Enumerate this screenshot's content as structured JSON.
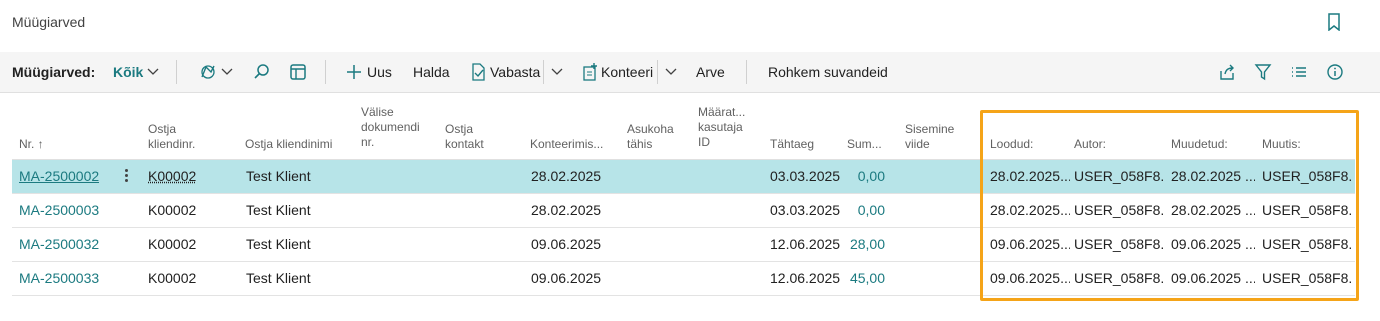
{
  "page": {
    "title": "Müügiarved"
  },
  "toolbar": {
    "list_label": "Müügiarved:",
    "filter_value": "Kõik",
    "new_label": "Uus",
    "manage_label": "Halda",
    "release_label": "Vabasta",
    "post_label": "Konteeri",
    "invoice_label": "Arve",
    "more_label": "Rohkem suvandeid"
  },
  "columns": {
    "nr": "Nr. ↑",
    "customer_no": "Ostja\nkliendinr.",
    "customer_name": "Ostja kliendinimi",
    "ext_doc": "Välise\ndokumendi\nnr.",
    "contact": "Ostja\nkontakt",
    "posting_date": "Konteerimis...",
    "location": "Asukoha\ntähis",
    "assigned_user": "Määrat...\nkasutaja\nID",
    "due_date": "Tähtaeg",
    "amount": "Sum...",
    "internal_ref": "Sisemine\nviide",
    "created": "Loodud:",
    "author": "Autor:",
    "modified": "Muudetud:",
    "modified_by": "Muutis:"
  },
  "rows": [
    {
      "nr": "MA-2500002",
      "customer_no": "K00002",
      "customer_name": "Test Klient",
      "posting_date": "28.02.2025",
      "due_date": "03.03.2025",
      "amount": "0,00",
      "created": "28.02.2025...",
      "author": "USER_058F8...",
      "modified": "28.02.2025 ...",
      "modified_by": "USER_058F8..."
    },
    {
      "nr": "MA-2500003",
      "customer_no": "K00002",
      "customer_name": "Test Klient",
      "posting_date": "28.02.2025",
      "due_date": "03.03.2025",
      "amount": "0,00",
      "created": "28.02.2025...",
      "author": "USER_058F8...",
      "modified": "28.02.2025 ...",
      "modified_by": "USER_058F8..."
    },
    {
      "nr": "MA-2500032",
      "customer_no": "K00002",
      "customer_name": "Test Klient",
      "posting_date": "09.06.2025",
      "due_date": "12.06.2025",
      "amount": "28,00",
      "created": "09.06.2025...",
      "author": "USER_058F8...",
      "modified": "09.06.2025 ...",
      "modified_by": "USER_058F8..."
    },
    {
      "nr": "MA-2500033",
      "customer_no": "K00002",
      "customer_name": "Test Klient",
      "posting_date": "09.06.2025",
      "due_date": "12.06.2025",
      "amount": "45,00",
      "created": "09.06.2025...",
      "author": "USER_058F8...",
      "modified": "09.06.2025 ...",
      "modified_by": "USER_058F8..."
    }
  ],
  "colors": {
    "accent": "#1b7a80",
    "selected_row": "#b7e4e8",
    "highlight": "#f5a418"
  },
  "icons": [
    "bookmark-icon",
    "chevron-down-icon",
    "analyze-icon",
    "search-icon",
    "edit-list-icon",
    "plus-icon",
    "release-icon",
    "post-icon",
    "share-icon",
    "filter-icon",
    "list-view-icon",
    "info-icon",
    "more-options-icon"
  ]
}
